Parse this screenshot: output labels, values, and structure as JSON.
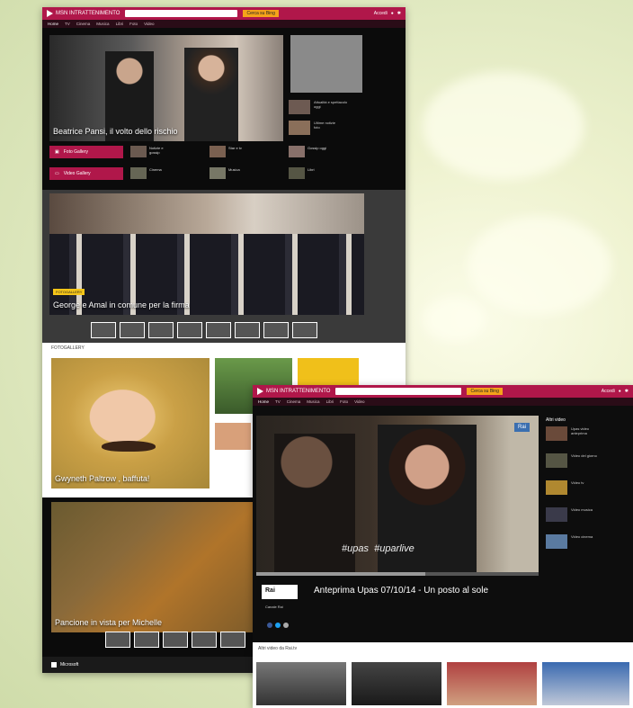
{
  "left_window": {
    "logo": "MSN INTRATTENIMENTO",
    "search_placeholder": "",
    "search_button": "Cerca su Bing",
    "account": "Accedi",
    "nav": [
      "Home",
      "TV",
      "Cinema",
      "Musica",
      "Libri",
      "Foto",
      "Video"
    ],
    "hero_caption": "Beatrice Pansi, il volto dello rischio",
    "buttons": [
      "Foto Gallery",
      "Video Gallery"
    ],
    "hero2_tag": "FOTOGALLERY",
    "hero2_caption": "George e Amal in comune per la firma",
    "foto_label": "FOTOGALLERY",
    "gwyneth_caption": "Gwyneth Paltrow , baffuta!",
    "michelle_caption": "Pancione in vista per Michelle",
    "footer_brand": "Microsoft"
  },
  "right_window": {
    "logo": "MSN INTRATTENIMENTO",
    "search_button": "Cerca su Bing",
    "account": "Accedi",
    "nav": [
      "Home",
      "TV",
      "Cinema",
      "Musica",
      "Libri",
      "Foto",
      "Video"
    ],
    "video_caption": "Anteprima Upas 07/10/14 - Un posto al sole",
    "video_overlay": "#upas  #uparlive",
    "channel_badge": "Rai",
    "channel_name": "Canale Rai",
    "side_title": "Altri video",
    "more_label": "Altri video da Rai.tv"
  }
}
